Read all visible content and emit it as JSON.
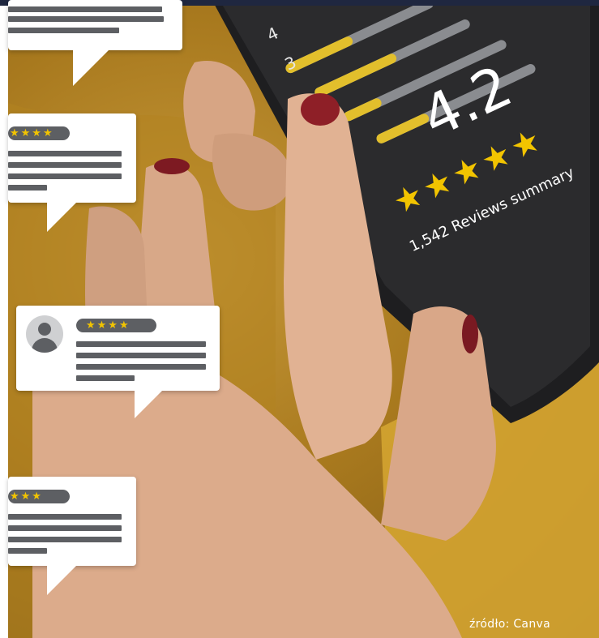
{
  "phone": {
    "rating": "4.2",
    "rating_stars": "★★★★★",
    "reviews_summary": "1,542 Reviews summary",
    "bar_labels": [
      "4",
      "3"
    ]
  },
  "review_cards": [
    {
      "stars": ""
    },
    {
      "stars": "★★★★"
    },
    {
      "stars": "★★★★"
    },
    {
      "stars": "★★★"
    }
  ],
  "caption": {
    "text": "źródło: Canva"
  },
  "colors": {
    "accent_yellow": "#f2c400",
    "bar_gray": "#8a8c90",
    "phone_screen": "#2b2b2d",
    "background_fabric": "#b08421",
    "card_bar_gray": "#5d5f63"
  },
  "icons": [
    "star-icon",
    "user-avatar-icon"
  ]
}
